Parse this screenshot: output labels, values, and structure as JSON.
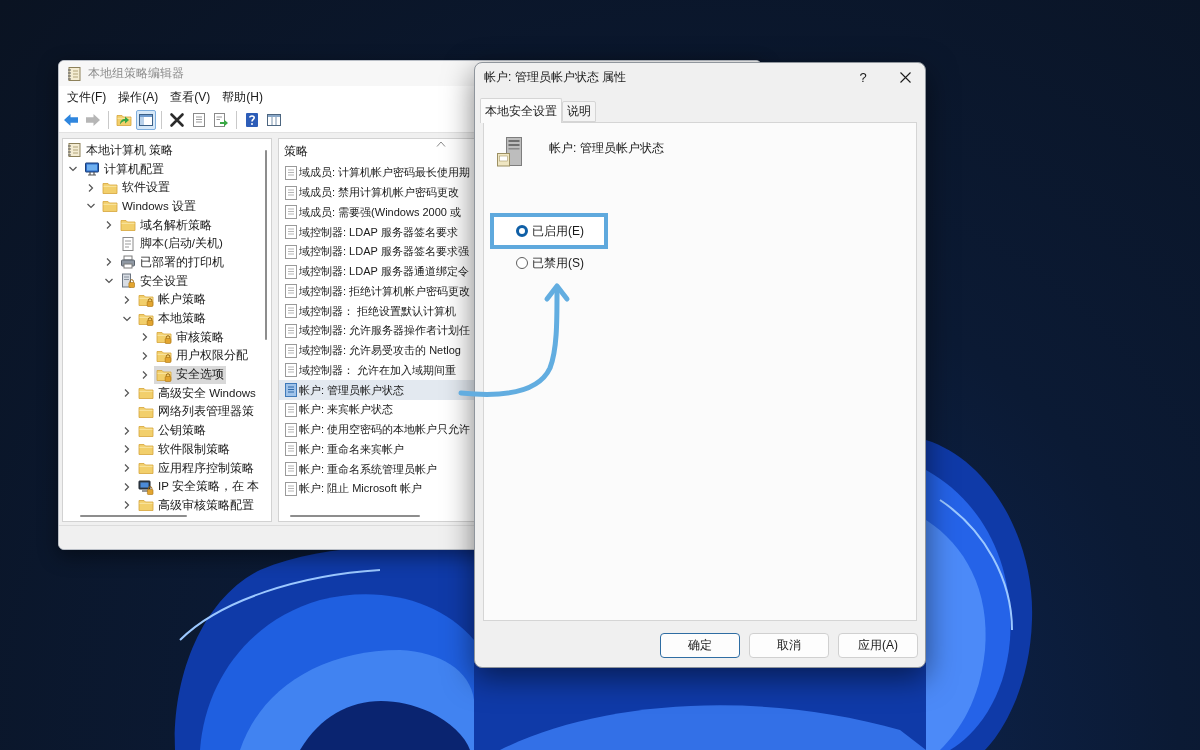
{
  "editor_window": {
    "title": "本地组策略编辑器",
    "menu": [
      "文件(F)",
      "操作(A)",
      "查看(V)",
      "帮助(H)"
    ],
    "toolbar": [
      {
        "pressed": false,
        "disabled": false
      },
      {
        "pressed": false,
        "disabled": true
      },
      {
        "pressed": false,
        "disabled": false
      },
      {
        "pressed": true,
        "disabled": false
      },
      {
        "pressed": false,
        "disabled": false
      },
      {
        "pressed": false,
        "disabled": false
      },
      {
        "pressed": false,
        "disabled": false
      },
      {
        "pressed": false,
        "disabled": false
      },
      {
        "pressed": false,
        "disabled": false
      }
    ],
    "tree": [
      {
        "label": "本地计算机 策略",
        "kind": "root",
        "selected": false,
        "children": [
          {
            "label": "计算机配置",
            "kind": "config",
            "selected": false,
            "expanded": true,
            "children": [
              {
                "label": "软件设置",
                "kind": "folder",
                "selected": false,
                "expanded": false
              },
              {
                "label": "Windows 设置",
                "kind": "folder",
                "selected": false,
                "expanded": true,
                "children": [
                  {
                    "label": "域名解析策略",
                    "kind": "folder",
                    "selected": false,
                    "expanded": false
                  },
                  {
                    "label": "脚本(启动/关机)",
                    "kind": "script",
                    "selected": false
                  },
                  {
                    "label": "已部署的打印机",
                    "kind": "printer",
                    "selected": false,
                    "expanded": false
                  },
                  {
                    "label": "安全设置",
                    "kind": "security",
                    "selected": false,
                    "expanded": true,
                    "children": [
                      {
                        "label": "帐户策略",
                        "kind": "policy_folder",
                        "selected": false,
                        "expanded": false
                      },
                      {
                        "label": "本地策略",
                        "kind": "policy_folder",
                        "selected": false,
                        "expanded": true,
                        "children": [
                          {
                            "label": "审核策略",
                            "kind": "policy_folder",
                            "selected": false,
                            "expanded": false
                          },
                          {
                            "label": "用户权限分配",
                            "kind": "policy_folder",
                            "selected": false,
                            "expanded": false
                          },
                          {
                            "label": "安全选项",
                            "kind": "policy_folder",
                            "selected": true,
                            "expanded": false
                          }
                        ]
                      },
                      {
                        "label": "高级安全 Windows",
                        "kind": "folder",
                        "selected": false,
                        "expanded": false
                      },
                      {
                        "label": "网络列表管理器策",
                        "kind": "folder",
                        "selected": false
                      },
                      {
                        "label": "公钥策略",
                        "kind": "folder",
                        "selected": false,
                        "expanded": false
                      },
                      {
                        "label": "软件限制策略",
                        "kind": "folder",
                        "selected": false,
                        "expanded": false
                      },
                      {
                        "label": "应用程序控制策略",
                        "kind": "folder",
                        "selected": false,
                        "expanded": false
                      },
                      {
                        "label": "IP 安全策略，在 本",
                        "kind": "ip_security",
                        "selected": false,
                        "expanded": false
                      },
                      {
                        "label": "高级审核策略配置",
                        "kind": "folder",
                        "selected": false,
                        "expanded": false
                      }
                    ]
                  }
                ]
              }
            ]
          }
        ]
      }
    ],
    "list": {
      "column": "策略",
      "items": [
        {
          "label": "域成员: 计算机帐户密码最长使用期",
          "selected": false
        },
        {
          "label": "域成员: 禁用计算机帐户密码更改",
          "selected": false
        },
        {
          "label": "域成员: 需要强(Windows 2000 或",
          "selected": false
        },
        {
          "label": "域控制器: LDAP 服务器签名要求",
          "selected": false
        },
        {
          "label": "域控制器: LDAP 服务器签名要求强",
          "selected": false
        },
        {
          "label": "域控制器: LDAP 服务器通道绑定令",
          "selected": false
        },
        {
          "label": "域控制器: 拒绝计算机帐户密码更改",
          "selected": false
        },
        {
          "label": "域控制器： 拒绝设置默认计算机",
          "selected": false
        },
        {
          "label": "域控制器: 允许服务器操作者计划任",
          "selected": false
        },
        {
          "label": "域控制器: 允许易受攻击的 Netlog",
          "selected": false
        },
        {
          "label": "域控制器： 允许在加入域期间重",
          "selected": false
        },
        {
          "label": "帐户: 管理员帐户状态",
          "selected": true
        },
        {
          "label": "帐户: 来宾帐户状态",
          "selected": false
        },
        {
          "label": "帐户: 使用空密码的本地帐户只允许",
          "selected": false
        },
        {
          "label": "帐户: 重命名来宾帐户",
          "selected": false
        },
        {
          "label": "帐户: 重命名系统管理员帐户",
          "selected": false
        },
        {
          "label": "帐户: 阻止 Microsoft 帐户",
          "selected": false
        }
      ]
    }
  },
  "properties_dialog": {
    "title": "帐户: 管理员帐户状态 属性",
    "help": "?",
    "tabs": [
      {
        "label": "本地安全设置",
        "selected": true
      },
      {
        "label": "说明",
        "selected": false
      }
    ],
    "policy_name": "帐户: 管理员帐户状态",
    "options": [
      {
        "label": "已启用(E)",
        "selected": true,
        "highlighted": true
      },
      {
        "label": "已禁用(S)",
        "selected": false,
        "highlighted": false
      }
    ],
    "buttons": [
      {
        "label": "确定",
        "default": true
      },
      {
        "label": "取消",
        "default": false
      },
      {
        "label": "应用(A)",
        "default": false
      }
    ]
  }
}
